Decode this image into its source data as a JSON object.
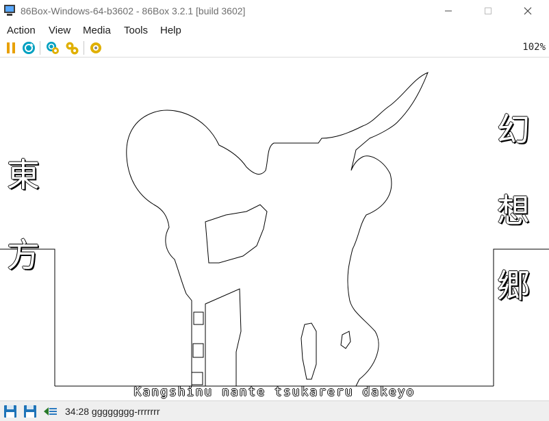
{
  "window": {
    "title": "86Box-Windows-64-b3602 - 86Box 3.2.1 [build 3602]",
    "minimize_glyph": "—",
    "maximize_glyph": "☐",
    "close_glyph": "✕"
  },
  "menu": {
    "items": [
      {
        "label": "Action"
      },
      {
        "label": "View"
      },
      {
        "label": "Media"
      },
      {
        "label": "Tools"
      },
      {
        "label": "Help"
      }
    ]
  },
  "toolbar": {
    "icons": [
      "pause-icon",
      "reset-icon",
      "hard-reset-icon",
      "settings-icon",
      "machine-settings-icon"
    ],
    "zoom": "102%"
  },
  "screen": {
    "kanji_left": [
      "東",
      "方"
    ],
    "kanji_right": [
      "幻",
      "想",
      "郷"
    ],
    "lyric": "Kangshinu nante tsukareru dakeyo"
  },
  "statusbar": {
    "icons": [
      "floppy-a-icon",
      "floppy-b-icon",
      "network-icon"
    ],
    "text": "34:28 gggggggg-rrrrrrr"
  },
  "colors": {
    "pause": "#e8a000",
    "reset": "#00a0c0",
    "settings": "#e0b000",
    "floppy": "#1f74b8",
    "network": "#2a7a2a"
  }
}
